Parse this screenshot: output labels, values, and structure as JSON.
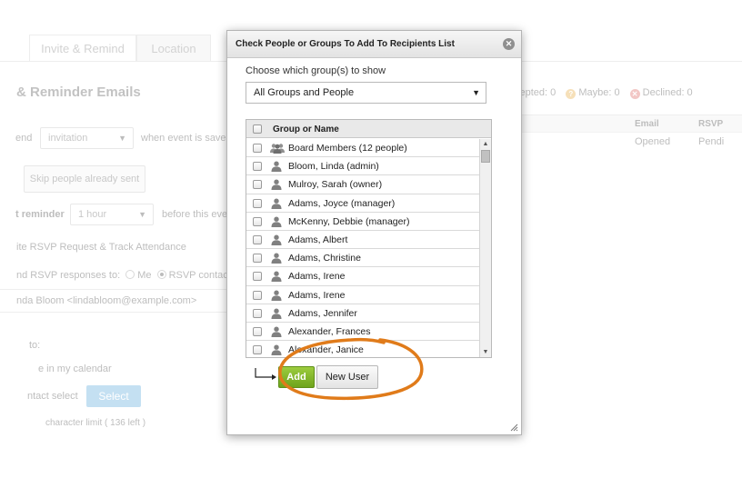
{
  "background": {
    "tabs": [
      {
        "label": "Invite & Remind"
      },
      {
        "label": "Location"
      }
    ],
    "section_heading": "& Reminder Emails",
    "send_label": "end",
    "invitation_select": "invitation",
    "when_saved_text": "when event is saved",
    "skip_button": "Skip people already sent",
    "reminder_label": "t reminder",
    "reminder_select": "1 hour",
    "before_text": "before this even",
    "rsvp_request_text": "ite RSVP Request & Track Attendance",
    "send_rsvp_text": "nd RSVP responses to:",
    "rsvp_me": "Me",
    "rsvp_contact": "RSVP contact",
    "email_value": "nda Bloom <lindabloom@example.com>",
    "to_label": "to:",
    "calendar_text": "e in my calendar",
    "contact_select_text": "ntact select",
    "select_button": "Select",
    "char_limit_prefix": "character limit (",
    "char_limit_value": "136",
    "char_limit_suffix": "left )",
    "accepted_text": "cepted: 0",
    "maybe_text": "Maybe: 0",
    "declined_text": "Declined: 0",
    "table_header_email": "Email",
    "table_header_rsvp": "RSVP",
    "table_row_email": "Opened",
    "table_row_rsvp": "Pendi"
  },
  "modal": {
    "title": "Check People or Groups To Add To Recipients List",
    "choose_label": "Choose which group(s) to show",
    "group_select_value": "All Groups and People",
    "list_header": "Group or Name",
    "rows": [
      {
        "label": "Board Members (12 people)",
        "icon": "group-icon"
      },
      {
        "label": "Bloom, Linda (admin)",
        "icon": "person-icon"
      },
      {
        "label": "Mulroy, Sarah (owner)",
        "icon": "person-icon"
      },
      {
        "label": "Adams, Joyce (manager)",
        "icon": "person-icon"
      },
      {
        "label": "McKenny, Debbie (manager)",
        "icon": "person-icon"
      },
      {
        "label": "Adams, Albert",
        "icon": "person-icon"
      },
      {
        "label": "Adams, Christine",
        "icon": "person-icon"
      },
      {
        "label": "Adams, Irene",
        "icon": "person-icon"
      },
      {
        "label": "Adams, Irene",
        "icon": "person-icon"
      },
      {
        "label": "Adams, Jennifer",
        "icon": "person-icon"
      },
      {
        "label": "Alexander, Frances",
        "icon": "person-icon"
      },
      {
        "label": "Alexander, Janice",
        "icon": "person-icon"
      }
    ],
    "add_button": "Add",
    "new_user_button": "New User"
  },
  "colors": {
    "add_green": "#7cb32a",
    "highlight_orange": "#e07b1a",
    "select_blue": "#4aa0d8"
  }
}
